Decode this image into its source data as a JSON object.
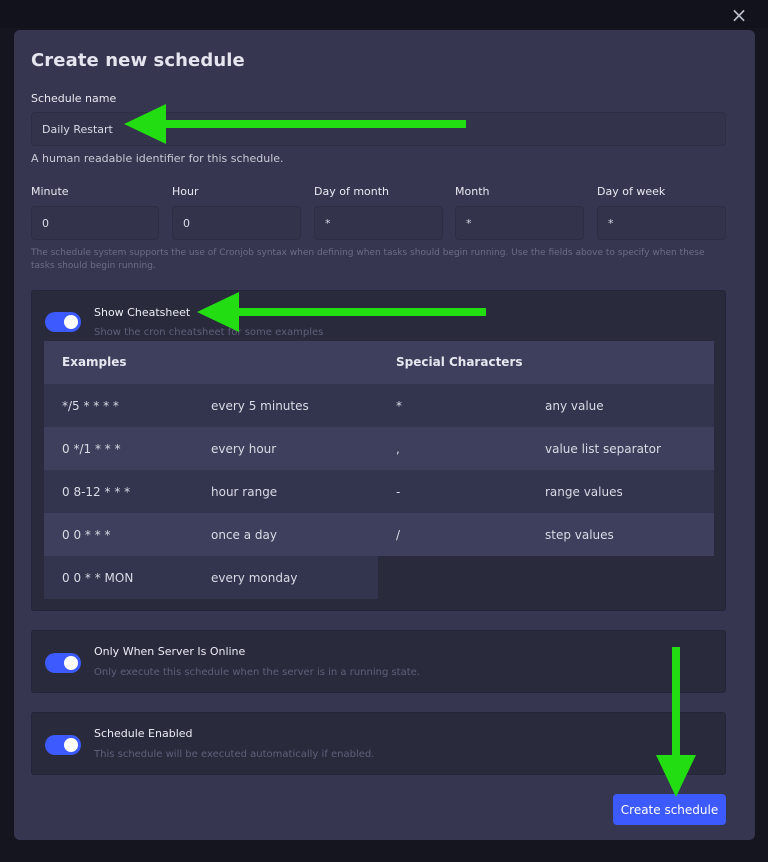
{
  "modal": {
    "close_icon": "×",
    "title": "Create new schedule",
    "schedule_name": {
      "label": "Schedule name",
      "value": "Daily Restart",
      "help": "A human readable identifier for this schedule."
    },
    "cron_fields": [
      {
        "label": "Minute",
        "value": "0"
      },
      {
        "label": "Hour",
        "value": "0"
      },
      {
        "label": "Day of month",
        "value": "*"
      },
      {
        "label": "Month",
        "value": "*"
      },
      {
        "label": "Day of week",
        "value": "*"
      }
    ],
    "cron_help": "The schedule system supports the use of Cronjob syntax when defining when tasks should begin running. Use the fields above to specify when these tasks should begin running.",
    "cheatsheet": {
      "title": "Show Cheatsheet",
      "description": "Show the cron cheatsheet for some examples",
      "enabled": true,
      "examples_header": "Examples",
      "special_header": "Special Characters",
      "examples": [
        {
          "expr": "*/5 * * * *",
          "desc": "every 5 minutes"
        },
        {
          "expr": "0 */1 * * *",
          "desc": "every hour"
        },
        {
          "expr": "0 8-12 * * *",
          "desc": "hour range"
        },
        {
          "expr": "0 0 * * *",
          "desc": "once a day"
        },
        {
          "expr": "0 0 * * MON",
          "desc": "every monday"
        }
      ],
      "specials": [
        {
          "char": "*",
          "desc": "any value"
        },
        {
          "char": ",",
          "desc": "value list separator"
        },
        {
          "char": "-",
          "desc": "range values"
        },
        {
          "char": "/",
          "desc": "step values"
        }
      ]
    },
    "only_online": {
      "title": "Only When Server Is Online",
      "description": "Only execute this schedule when the server is in a running state.",
      "enabled": true
    },
    "schedule_enabled": {
      "title": "Schedule Enabled",
      "description": "This schedule will be executed automatically if enabled.",
      "enabled": true
    },
    "create_button": "Create schedule"
  },
  "colors": {
    "accent": "#3d5afe",
    "annotation_arrow": "#22dd11",
    "modal_bg": "#363650"
  }
}
